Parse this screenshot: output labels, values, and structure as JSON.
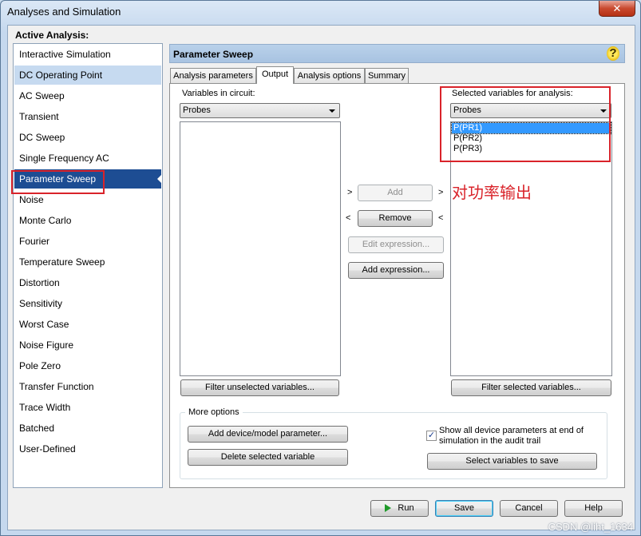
{
  "window": {
    "title": "Analyses and Simulation",
    "close_glyph": "✕"
  },
  "active_analysis_label": "Active Analysis:",
  "analyses": [
    "Interactive Simulation",
    "DC Operating Point",
    "AC Sweep",
    "Transient",
    "DC Sweep",
    "Single Frequency AC",
    "Parameter Sweep",
    "Noise",
    "Monte Carlo",
    "Fourier",
    "Temperature Sweep",
    "Distortion",
    "Sensitivity",
    "Worst Case",
    "Noise Figure",
    "Pole Zero",
    "Transfer Function",
    "Trace Width",
    "Batched",
    "User-Defined"
  ],
  "selected_analysis": "Parameter Sweep",
  "panel": {
    "title": "Parameter Sweep",
    "help_glyph": "?"
  },
  "tabs": [
    "Analysis parameters",
    "Output",
    "Analysis options",
    "Summary"
  ],
  "active_tab": "Output",
  "left_list": {
    "label": "Variables in circuit:",
    "combo_value": "Probes",
    "items": [],
    "filter_button": "Filter unselected variables..."
  },
  "right_list": {
    "label": "Selected variables for analysis:",
    "combo_value": "Probes",
    "items": [
      "P(PR1)",
      "P(PR2)",
      "P(PR3)"
    ],
    "selected_item": "P(PR1)",
    "filter_button": "Filter selected variables..."
  },
  "middle": {
    "add_label": "Add",
    "remove_label": "Remove",
    "edit_expression_label": "Edit expression...",
    "add_expression_label": "Add expression...",
    "arrow_right": ">",
    "arrow_left": "<"
  },
  "annotation_text": "对功率输出",
  "more_options": {
    "title": "More options",
    "add_param_button": "Add device/model parameter...",
    "delete_var_button": "Delete selected variable",
    "show_params_checkbox": "Show all device parameters at end of simulation in the audit trail",
    "show_params_checked": true,
    "check_glyph": "✓",
    "select_save_button": "Select variables to save"
  },
  "footer": {
    "run_label": "Run",
    "save_label": "Save",
    "cancel_label": "Cancel",
    "help_label": "Help"
  },
  "watermark": "CSDN @liht_1634",
  "colors": {
    "selection": "#1d4d93",
    "annotation": "#d9232a",
    "list_highlight": "#3399ff"
  }
}
